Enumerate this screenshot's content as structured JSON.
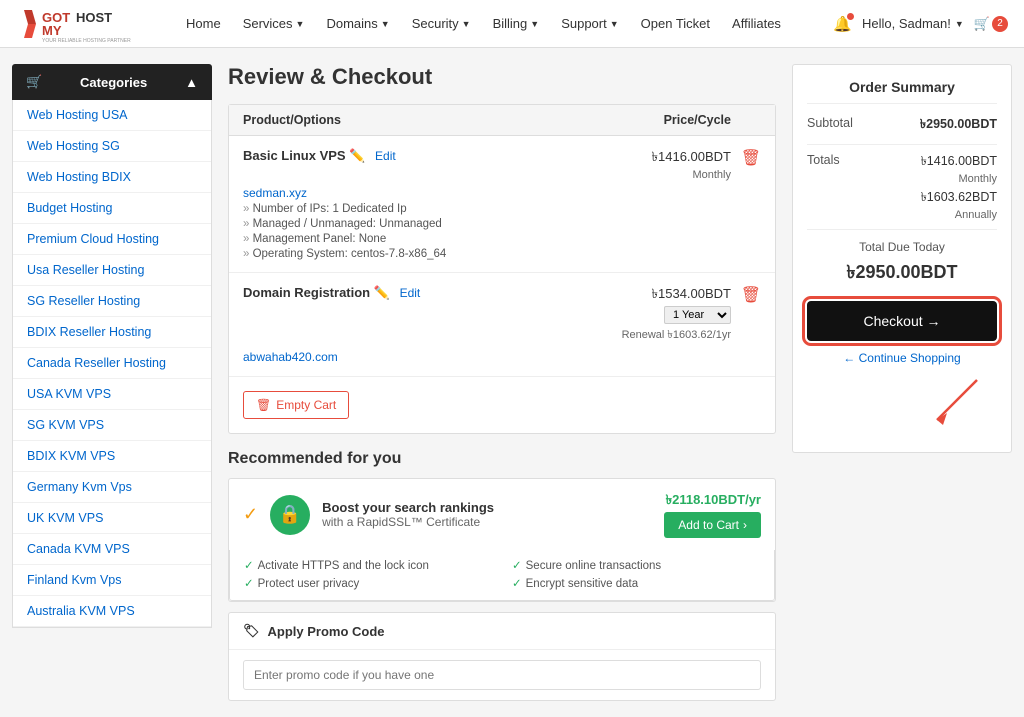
{
  "brand": {
    "name": "GOTMYHOST",
    "tagline": "YOUR RELIABLE HOSTING PARTNER"
  },
  "navbar": {
    "links": [
      {
        "label": "Home",
        "has_dropdown": false
      },
      {
        "label": "Services",
        "has_dropdown": true
      },
      {
        "label": "Domains",
        "has_dropdown": true
      },
      {
        "label": "Security",
        "has_dropdown": true
      },
      {
        "label": "Billing",
        "has_dropdown": true
      },
      {
        "label": "Support",
        "has_dropdown": true
      },
      {
        "label": "Open Ticket",
        "has_dropdown": false
      },
      {
        "label": "Affiliates",
        "has_dropdown": false
      }
    ],
    "user_greeting": "Hello, Sadman!",
    "cart_count": "2"
  },
  "sidebar": {
    "header": "Categories",
    "items": [
      {
        "label": "Web Hosting USA"
      },
      {
        "label": "Web Hosting SG"
      },
      {
        "label": "Web Hosting BDIX"
      },
      {
        "label": "Budget Hosting"
      },
      {
        "label": "Premium Cloud Hosting"
      },
      {
        "label": "Usa Reseller Hosting"
      },
      {
        "label": "SG Reseller Hosting"
      },
      {
        "label": "BDIX Reseller Hosting"
      },
      {
        "label": "Canada Reseller Hosting"
      },
      {
        "label": "USA KVM VPS"
      },
      {
        "label": "SG KVM VPS"
      },
      {
        "label": "BDIX KVM VPS"
      },
      {
        "label": "Germany Kvm Vps"
      },
      {
        "label": "UK KVM VPS"
      },
      {
        "label": "Canada KVM VPS"
      },
      {
        "label": "Finland Kvm Vps"
      },
      {
        "label": "Australia KVM VPS"
      }
    ]
  },
  "main": {
    "page_title": "Review & Checkout",
    "table_headers": {
      "product": "Product/Options",
      "price": "Price/Cycle"
    },
    "cart_items": [
      {
        "name": "Basic Linux VPS",
        "edit_label": "Edit",
        "price": "৳1416.00BDT",
        "cycle": "Monthly",
        "domain": "sedman.xyz",
        "details": [
          "Number of IPs: 1 Dedicated Ip",
          "Managed / Unmanaged: Unmanaged",
          "Management Panel: None",
          "Operating System: centos-7.8-x86_64"
        ]
      },
      {
        "name": "Domain Registration",
        "edit_label": "Edit",
        "price": "৳1534.00BDT",
        "cycle": "1 Year",
        "domain": "abwahab420.com",
        "renewal": "Renewal ৳1603.62/1yr",
        "details": []
      }
    ],
    "empty_cart_label": "Empty Cart",
    "recommended_title": "Recommended for you",
    "ssl_card": {
      "title": "Boost your search rankings",
      "subtitle": "with a RapidSSL™ Certificate",
      "price": "৳2118.10BDT/yr",
      "add_label": "Add to Cart"
    },
    "ssl_features": [
      "Activate HTTPS and the lock icon",
      "Protect user privacy",
      "Secure online transactions",
      "Encrypt sensitive data"
    ],
    "promo": {
      "header": "Apply Promo Code",
      "input_placeholder": "Enter promo code if you have one"
    }
  },
  "order_summary": {
    "title": "Order Summary",
    "subtotal_label": "Subtotal",
    "subtotal_value": "৳2950.00BDT",
    "totals_label": "Totals",
    "totals_monthly": "৳1416.00BDT",
    "totals_monthly_label": "Monthly",
    "totals_annually": "৳1603.62BDT",
    "totals_annually_label": "Annually",
    "total_due_label": "Total Due Today",
    "total_due_value": "৳2950.00BDT",
    "checkout_label": "Checkout →",
    "continue_label": "← Continue Shopping"
  }
}
